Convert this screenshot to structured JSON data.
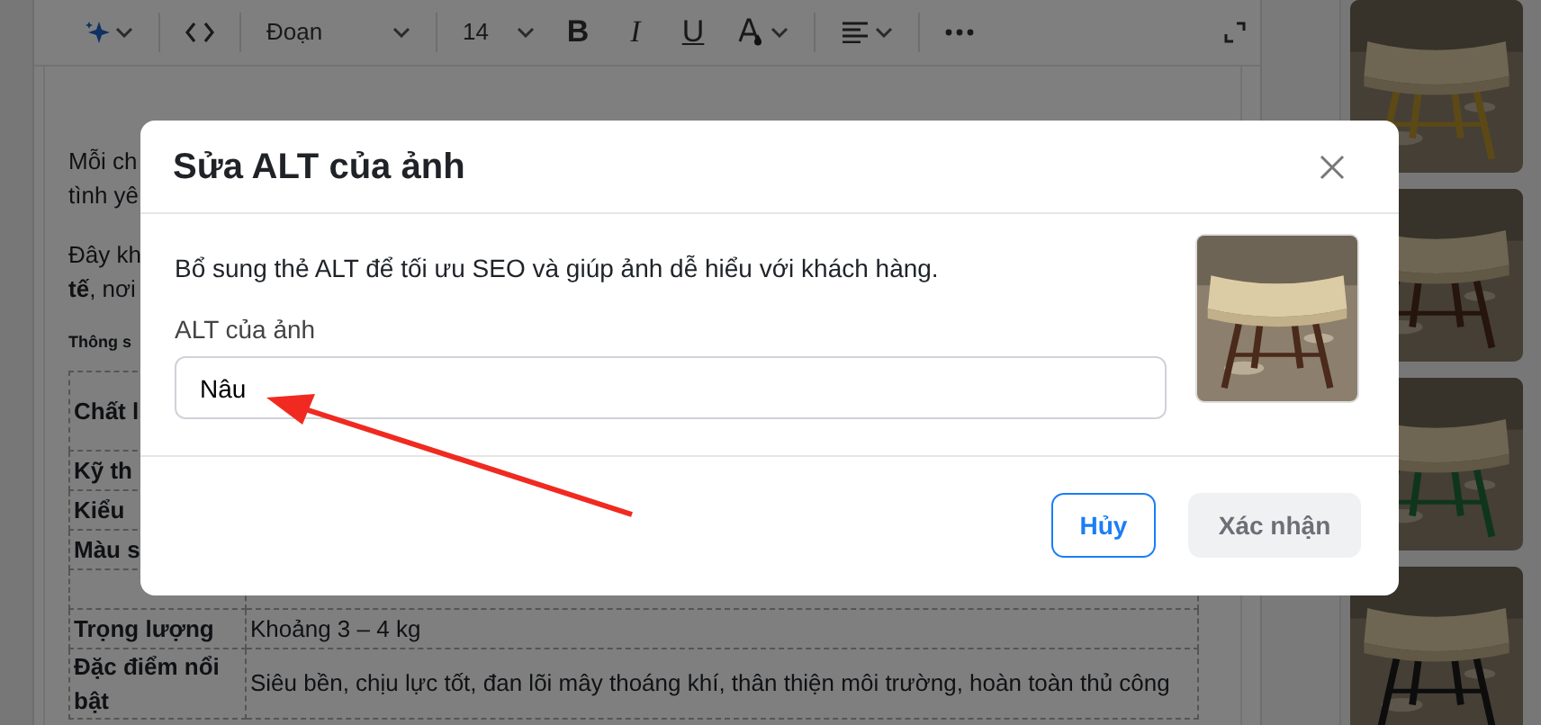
{
  "toolbar": [
    {
      "kind": "ai-menu"
    },
    {
      "kind": "code"
    },
    {
      "kind": "block-select",
      "value": "Đoạn"
    },
    {
      "kind": "size-select",
      "value": "14"
    },
    {
      "kind": "bold",
      "label": "B"
    },
    {
      "kind": "italic",
      "label": "I"
    },
    {
      "kind": "underline",
      "label": "U"
    },
    {
      "kind": "color-menu"
    },
    {
      "kind": "align-menu"
    },
    {
      "kind": "more"
    },
    {
      "kind": "expand"
    }
  ],
  "paragraphs": [
    {
      "lines": [
        "Mỗi ch",
        "tình yê"
      ]
    },
    {
      "lines": [
        "Đây kh",
        "**tế**, nơi"
      ]
    }
  ],
  "spec_heading": "Thông s",
  "spec_table": [
    {
      "kind": "row",
      "label": "Chất l"
    },
    {
      "kind": "row",
      "label": "Kỹ th"
    },
    {
      "kind": "row",
      "label": "Kiểu"
    },
    {
      "kind": "row",
      "label": "Màu s"
    },
    {
      "kind": "covered"
    },
    {
      "kind": "row",
      "label": "Trọng lượng",
      "value": "Khoảng 3 – 4 kg"
    },
    {
      "kind": "row",
      "label": "Đặc điểm nổi bật",
      "value": "Siêu bền, chịu lực tốt, đan lõi mây thoáng khí, thân thiện môi trường, hoàn toàn thủ công"
    }
  ],
  "dialog": {
    "title": "Sửa ALT của ảnh",
    "description": "Bổ sung thẻ ALT để tối ưu SEO và giúp ảnh dễ hiểu với khách hàng.",
    "field_label": "ALT của ảnh",
    "field_value": "Nâu",
    "buttons": [
      {
        "label": "Hủy",
        "kind": "outline"
      },
      {
        "label": "Xác nhận",
        "kind": "muted"
      }
    ]
  }
}
